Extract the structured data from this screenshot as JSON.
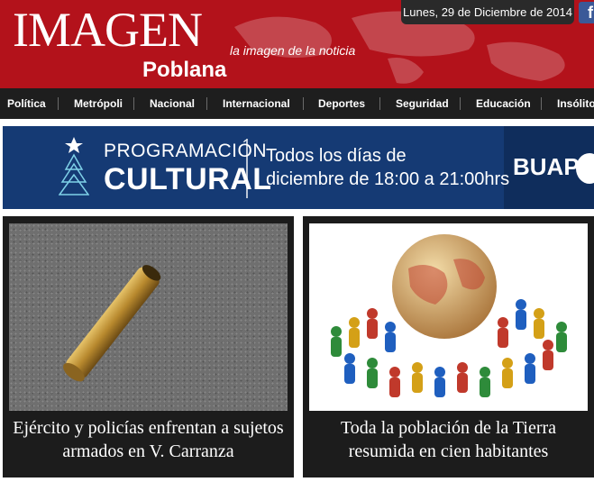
{
  "header": {
    "logo_main": "IMAGEN",
    "logo_sub": "Poblana",
    "tagline": "la imagen de la noticia",
    "date": "Lunes, 29 de Diciembre de 2014",
    "facebook_icon": "facebook-icon"
  },
  "nav": {
    "items": [
      "Política",
      "Metrópoli",
      "Nacional",
      "Internacional",
      "Deportes",
      "Seguridad",
      "Educación",
      "Insólito"
    ]
  },
  "banner": {
    "line_programacion": "PROGRAMACIÓN",
    "line_cultural": "CULTURAL",
    "schedule_line1": "Todos los días de",
    "schedule_line2": "diciembre de 18:00 a 21:00hrs",
    "sponsor": "BUAP"
  },
  "articles": [
    {
      "title": "Ejército y policías enfrentan a sujetos armados en V. Carranza",
      "image": "bullet-casing-photo"
    },
    {
      "title": "Toda la población de la Tierra resumida en cien habitantes",
      "image": "globe-with-game-pieces-photo"
    }
  ],
  "colors": {
    "header_red": "#b3121b",
    "nav_dark": "#1e1e1e",
    "banner_blue": "#153a74",
    "card_dark": "#1c1c1c"
  }
}
